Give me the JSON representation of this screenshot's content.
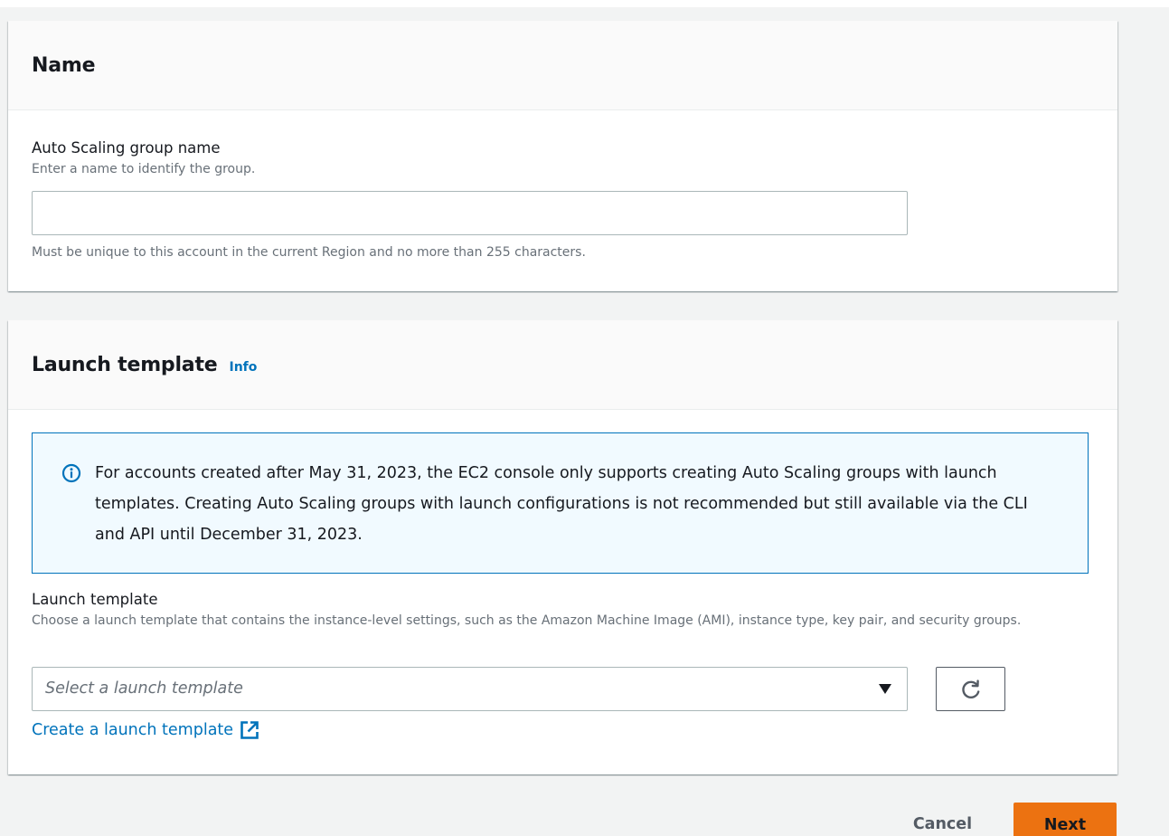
{
  "name_section": {
    "title": "Name",
    "field_label": "Auto Scaling group name",
    "field_description": "Enter a name to identify the group.",
    "input_value": "",
    "input_placeholder": "",
    "constraint_text": "Must be unique to this account in the current Region and no more than 255 characters."
  },
  "launch_section": {
    "title": "Launch template",
    "info_label": "Info",
    "alert": {
      "icon": "info-circle-icon",
      "text": "For accounts created after May 31, 2023, the EC2 console only supports creating Auto Scaling groups with launch templates. Creating Auto Scaling groups with launch configurations is not recommended but still available via the CLI and API until December 31, 2023."
    },
    "field_label": "Launch template",
    "field_description": "Choose a launch template that contains the instance-level settings, such as the Amazon Machine Image (AMI), instance type, key pair, and security groups.",
    "select_placeholder": "Select a launch template",
    "create_link": "Create a launch template",
    "refresh_icon": "refresh-icon",
    "external_icon": "external-link-icon"
  },
  "footer": {
    "cancel_label": "Cancel",
    "next_label": "Next"
  },
  "colors": {
    "link": "#0073bb",
    "primary_button": "#ec7211",
    "alert_border": "#0073bb",
    "alert_background": "#f1faff",
    "page_background": "#f2f3f3"
  }
}
